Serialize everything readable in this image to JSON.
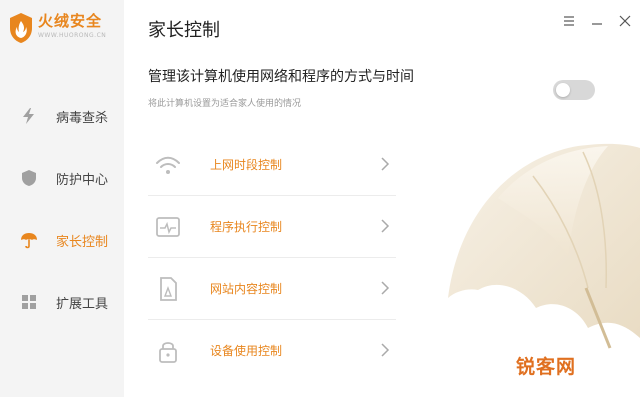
{
  "app": {
    "logo_title": "火绒安全",
    "logo_subtitle": "WWW.HUORONG.CN",
    "brand_color": "#e8861e"
  },
  "window_controls": [
    {
      "icon": "menu-icon"
    },
    {
      "icon": "minimize-icon"
    },
    {
      "icon": "close-icon"
    }
  ],
  "sidebar": {
    "items": [
      {
        "label": "病毒查杀",
        "icon": "lightning-icon",
        "active": false
      },
      {
        "label": "防护中心",
        "icon": "shield-icon",
        "active": false
      },
      {
        "label": "家长控制",
        "icon": "umbrella-icon",
        "active": true
      },
      {
        "label": "扩展工具",
        "icon": "grid-icon",
        "active": false
      }
    ]
  },
  "header": {
    "title": "家长控制"
  },
  "main": {
    "heading": "管理该计算机使用网络和程序的方式与时间",
    "subheading": "将此计算机设置为适合家人使用的情况",
    "toggle_enabled": false,
    "controls": [
      {
        "label": "上网时段控制",
        "icon": "wifi-icon"
      },
      {
        "label": "程序执行控制",
        "icon": "program-monitor-icon"
      },
      {
        "label": "网站内容控制",
        "icon": "web-document-icon"
      },
      {
        "label": "设备使用控制",
        "icon": "lock-icon"
      }
    ]
  },
  "watermark": {
    "text": "锐客网"
  }
}
